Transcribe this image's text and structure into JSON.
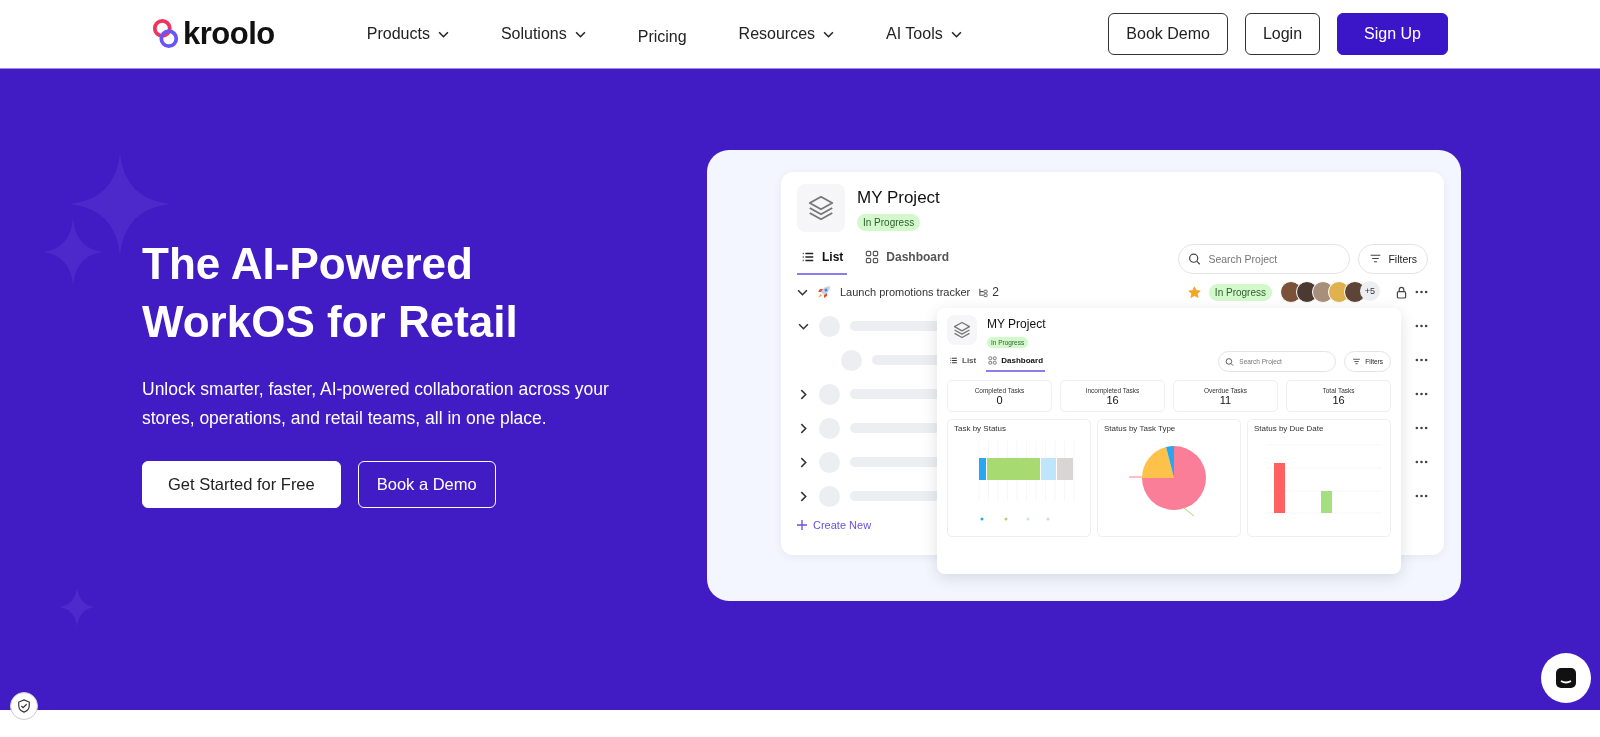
{
  "nav": {
    "logo": "kroolo",
    "links": [
      {
        "label": "Products",
        "dropdown": true
      },
      {
        "label": "Solutions",
        "dropdown": true
      },
      {
        "label": "Pricing",
        "dropdown": false
      },
      {
        "label": "Resources",
        "dropdown": true
      },
      {
        "label": "AI Tools",
        "dropdown": true
      }
    ],
    "buttons": [
      {
        "label": "Book Demo",
        "kind": "outline"
      },
      {
        "label": "Login",
        "kind": "outline"
      },
      {
        "label": "Sign Up",
        "kind": "primary"
      }
    ]
  },
  "hero": {
    "title": "The AI-Powered WorkOS for Retail",
    "subtitle": "Unlock smarter, faster, AI-powered collaboration across your stores, operations, and retail teams, all in one place.",
    "buttons": [
      {
        "label": "Get Started for Free",
        "kind": "solid"
      },
      {
        "label": "Book a Demo",
        "kind": "outline"
      }
    ]
  },
  "project": {
    "title": "MY Project",
    "status": "In Progress",
    "tabs": [
      {
        "label": "List",
        "selected": true
      },
      {
        "label": "Dashboard",
        "selected": false
      }
    ],
    "search": {
      "placeholder": "Search Project"
    },
    "filters": "Filters",
    "task": {
      "name": "Launch promotions tracker",
      "subtasks": "2",
      "starred": true,
      "status": "In Progress",
      "more_people": "+5"
    },
    "rows": [
      {
        "kind": "placeholder",
        "expanded": true,
        "children": [
          {
            "kind": "placeholder"
          }
        ]
      },
      {
        "kind": "placeholder",
        "expanded": false
      },
      {
        "kind": "placeholder",
        "expanded": false
      },
      {
        "kind": "placeholder",
        "expanded": false
      },
      {
        "kind": "placeholder",
        "expanded": false
      }
    ],
    "create": "Create New"
  },
  "dashboard": {
    "title": "MY Project",
    "status": "In Progress",
    "tabs": [
      {
        "label": "List",
        "selected": false
      },
      {
        "label": "Dashboard",
        "selected": true
      }
    ],
    "search": {
      "placeholder": "Search Project"
    },
    "filters": "Filters",
    "stats": [
      {
        "label": "Completed Tasks",
        "value": "0"
      },
      {
        "label": "Incompleted Tasks",
        "value": "16"
      },
      {
        "label": "Overdue Tasks",
        "value": "11"
      },
      {
        "label": "Total Tasks",
        "value": "16"
      }
    ],
    "charts": [
      {
        "title": "Task by Status",
        "kind": "stacked-bar"
      },
      {
        "title": "Status by Task Type",
        "kind": "pie"
      },
      {
        "title": "Status by Due Date",
        "kind": "column"
      }
    ]
  }
}
